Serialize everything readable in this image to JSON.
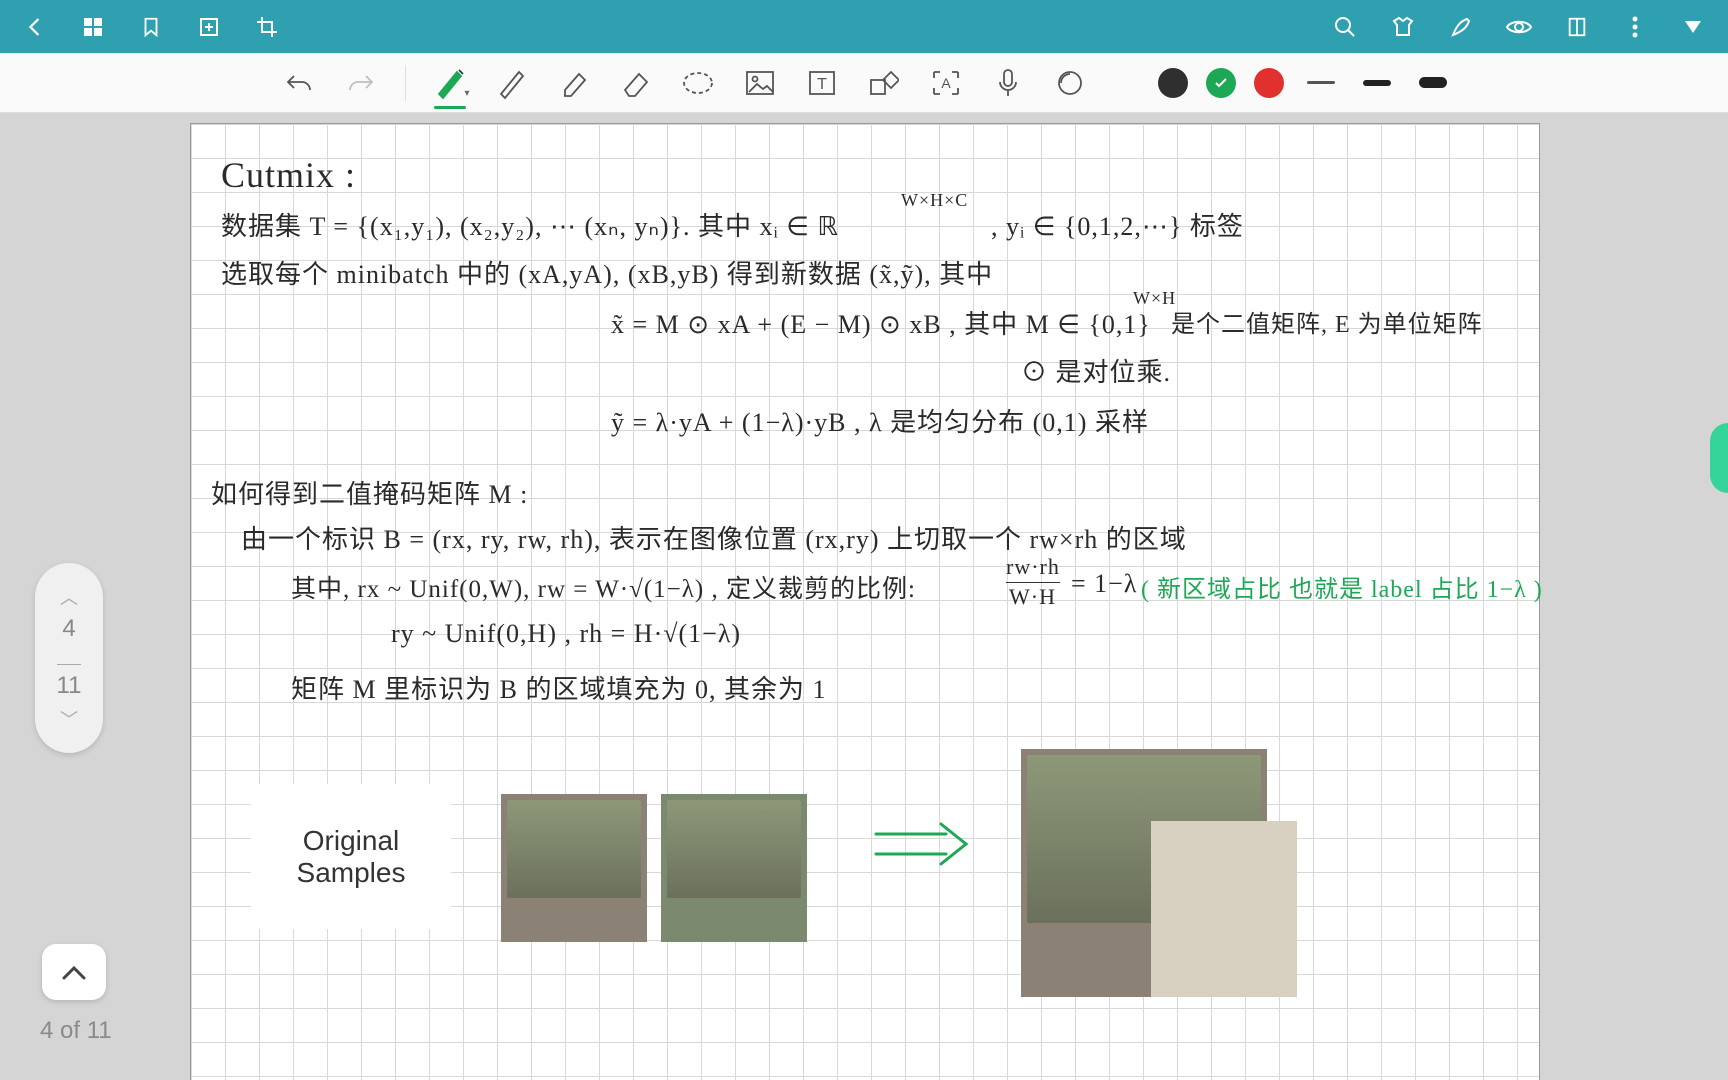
{
  "topbar": {
    "icons": {
      "back": "back-icon",
      "grid": "grid-icon",
      "bookmark": "bookmark-icon",
      "add_page": "add-page-icon",
      "crop": "crop-icon",
      "search": "search-icon",
      "shirt": "template-icon",
      "pen_edit": "edit-icon",
      "eye": "preview-icon",
      "column": "split-icon",
      "more": "more-icon",
      "heart": "favorite-icon"
    }
  },
  "toolbar": {
    "undo": "undo",
    "redo": "redo",
    "pen": "pen-tool",
    "pencil": "pencil-tool",
    "highlighter": "highlighter-tool",
    "eraser": "eraser-tool",
    "lasso": "lasso-tool",
    "image": "image-tool",
    "text": "text-tool",
    "shape": "shape-tool",
    "ocr": "ocr-tool",
    "mic": "mic-tool",
    "circle_tool": "circle-tool",
    "colors": {
      "black": "#2f2f2f",
      "green": "#1da855",
      "red": "#e0312f"
    },
    "strokes": [
      "thin",
      "medium",
      "thick"
    ]
  },
  "notes": {
    "title": "Cutmix :",
    "l1": "数据集 T = {(x₁,y₁), (x₂,y₂), ⋯ (xₙ, yₙ)}.  其中 xᵢ ∈ ℝ",
    "l1sup": "W×H×C",
    "l1b": ",  yᵢ ∈ {0,1,2,⋯} 标签",
    "l2": "选取每个 minibatch 中的 (xA,yA), (xB,yB) 得到新数据 (x̃,ỹ), 其中",
    "l3": "x̃ = M ⊙ xA + (E − M) ⊙ xB ,  其中 M ∈ {0,1}",
    "l3sup": "W×H",
    "l3b": " 是个二值矩阵, E 为单位矩阵",
    "l3c": "⊙ 是对位乘.",
    "l4": "ỹ = λ·yA + (1−λ)·yB  ,   λ 是均匀分布 (0,1) 采样",
    "l5": "如何得到二值掩码矩阵 M :",
    "l6": "由一个标识 B = (rx, ry, rw, rh), 表示在图像位置 (rx,ry) 上切取一个 rw×rh 的区域",
    "l7a": "其中,   rx ~ Unif(0,W),   rw = W·√(1−λ) ,   定义裁剪的比例:",
    "l7frac": "rw·rh / W·H",
    "l7eq": " = 1−λ",
    "l7green": "( 新区域占比 也就是 label 占比 1−λ )",
    "l8": "ry ~ Unif(0,H) ,   rh = H·√(1−λ)",
    "l9": "矩阵 M 里标识为 B 的区域填充为 0, 其余为 1",
    "sample1": "Original",
    "sample2": "Samples"
  },
  "pagenav": {
    "current": "4",
    "total": "11"
  },
  "footer": {
    "counter": "4 of 11"
  }
}
